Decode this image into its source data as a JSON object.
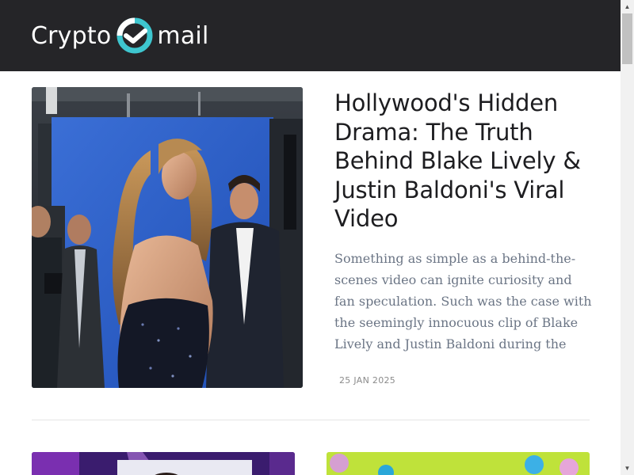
{
  "header": {
    "logo_left": "Crypto",
    "logo_right": "mail"
  },
  "featured": {
    "image_alt": "Woman in a sequined backless dress looking over her shoulder, with photographers and men in suits behind her",
    "title": "Hollywood's Hidden Drama: The Truth Behind Blake Lively & Justin Baldoni's Viral Video",
    "excerpt": "Something as simple as a behind-the-scenes video can ignite curiosity and fan speculation. Such was the case with the seemingly innocuous clip of Blake Lively and Justin Baldoni during the",
    "date": "25 JAN 2025"
  },
  "colors": {
    "header_bg": "#252528",
    "logo_accent": "#3ec6cf",
    "title": "#1d1d20",
    "excerpt": "#6b7585",
    "date": "#8b8b8b"
  },
  "icons": {
    "logo_mark": "check-circle-icon",
    "scroll_up": "triangle-up",
    "scroll_down": "triangle-down"
  },
  "scrollbar": {
    "up_glyph": "▲",
    "down_glyph": "▼"
  }
}
